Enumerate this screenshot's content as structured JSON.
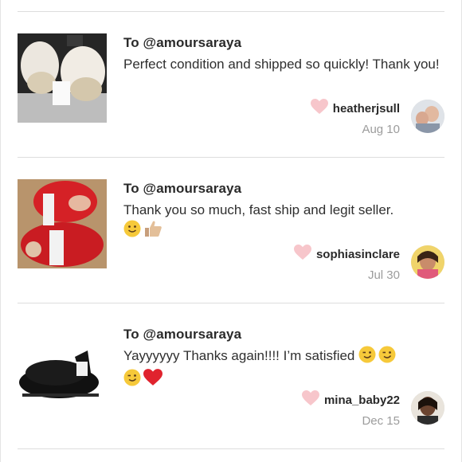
{
  "reviews": [
    {
      "to": "To @amoursaraya",
      "message": "Perfect condition and shipped so quickly! Thank you!",
      "emojis": [],
      "username": "heatherjsull",
      "date": "Aug 10"
    },
    {
      "to": "To @amoursaraya",
      "message": "Thank you so much, fast ship and legit seller.",
      "emojis": [
        "slightly-smiling-face",
        "thumbs-up"
      ],
      "username": "sophiasinclare",
      "date": "Jul 30"
    },
    {
      "to": "To @amoursaraya",
      "message": "Yayyyyyy Thanks again!!!! I’m satisfied",
      "emojis": [
        "winking-face",
        "winking-face",
        "winking-face",
        "red-heart"
      ],
      "username": "mina_baby22",
      "date": "Dec 15"
    }
  ],
  "colors": {
    "heart": "#f7c6cb",
    "divider": "#dddddd",
    "date": "#9c9c9c"
  },
  "icons": {
    "like": "heart-icon"
  }
}
